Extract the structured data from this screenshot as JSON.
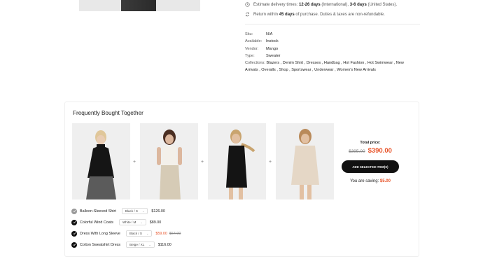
{
  "delivery": {
    "prefix": "Estimate delivery times:",
    "intl": "12-26 days",
    "intl_label": "(International),",
    "us": "3-6 days",
    "us_label": "(United States)."
  },
  "returns": {
    "prefix": "Return within",
    "days": "45 days",
    "suffix": "of purchase. Duties & taxes are non-refundable."
  },
  "meta": {
    "sku_label": "Sku:",
    "sku": "N/A",
    "available_label": "Available:",
    "available": "Instock",
    "vendor_label": "Vendor:",
    "vendor": "Mango",
    "type_label": "Type:",
    "type": "Sweater",
    "collections_label": "Collections:",
    "collections_line1": "Blazers , Denim Shirt , Dresses , Handbag , Hot Fashion , Hot Swimwear , New",
    "collections_line2": "Arrivals , Overalls , Shop , Sportswear , Underwear , Women's New Arrivals"
  },
  "fbt": {
    "title": "Frequently Bought Together",
    "plus": "+",
    "total_label": "Total price:",
    "old_price": "$395.00",
    "new_price": "$390.00",
    "add_button": "ADD SELECTED ITEM(S)",
    "saving_label": "You are saving:",
    "saving_amount": "$5.00",
    "items": [
      {
        "name": "Balloon-Sleeved Shirt",
        "variant": "Black / S",
        "price": "$126.00"
      },
      {
        "name": "Colorful Wind Coats",
        "variant": "White / M",
        "price": "$89.00"
      },
      {
        "name": "Dress With Long Sleeve",
        "variant": "Black / S",
        "sale_price": "$59.00",
        "compare_price": "$64.00"
      },
      {
        "name": "Cotton Sweatshirt Dress",
        "variant": "Beige / XL",
        "price": "$116.00"
      }
    ]
  },
  "colors": {
    "accent": "#e8542a",
    "button": "#111111"
  }
}
